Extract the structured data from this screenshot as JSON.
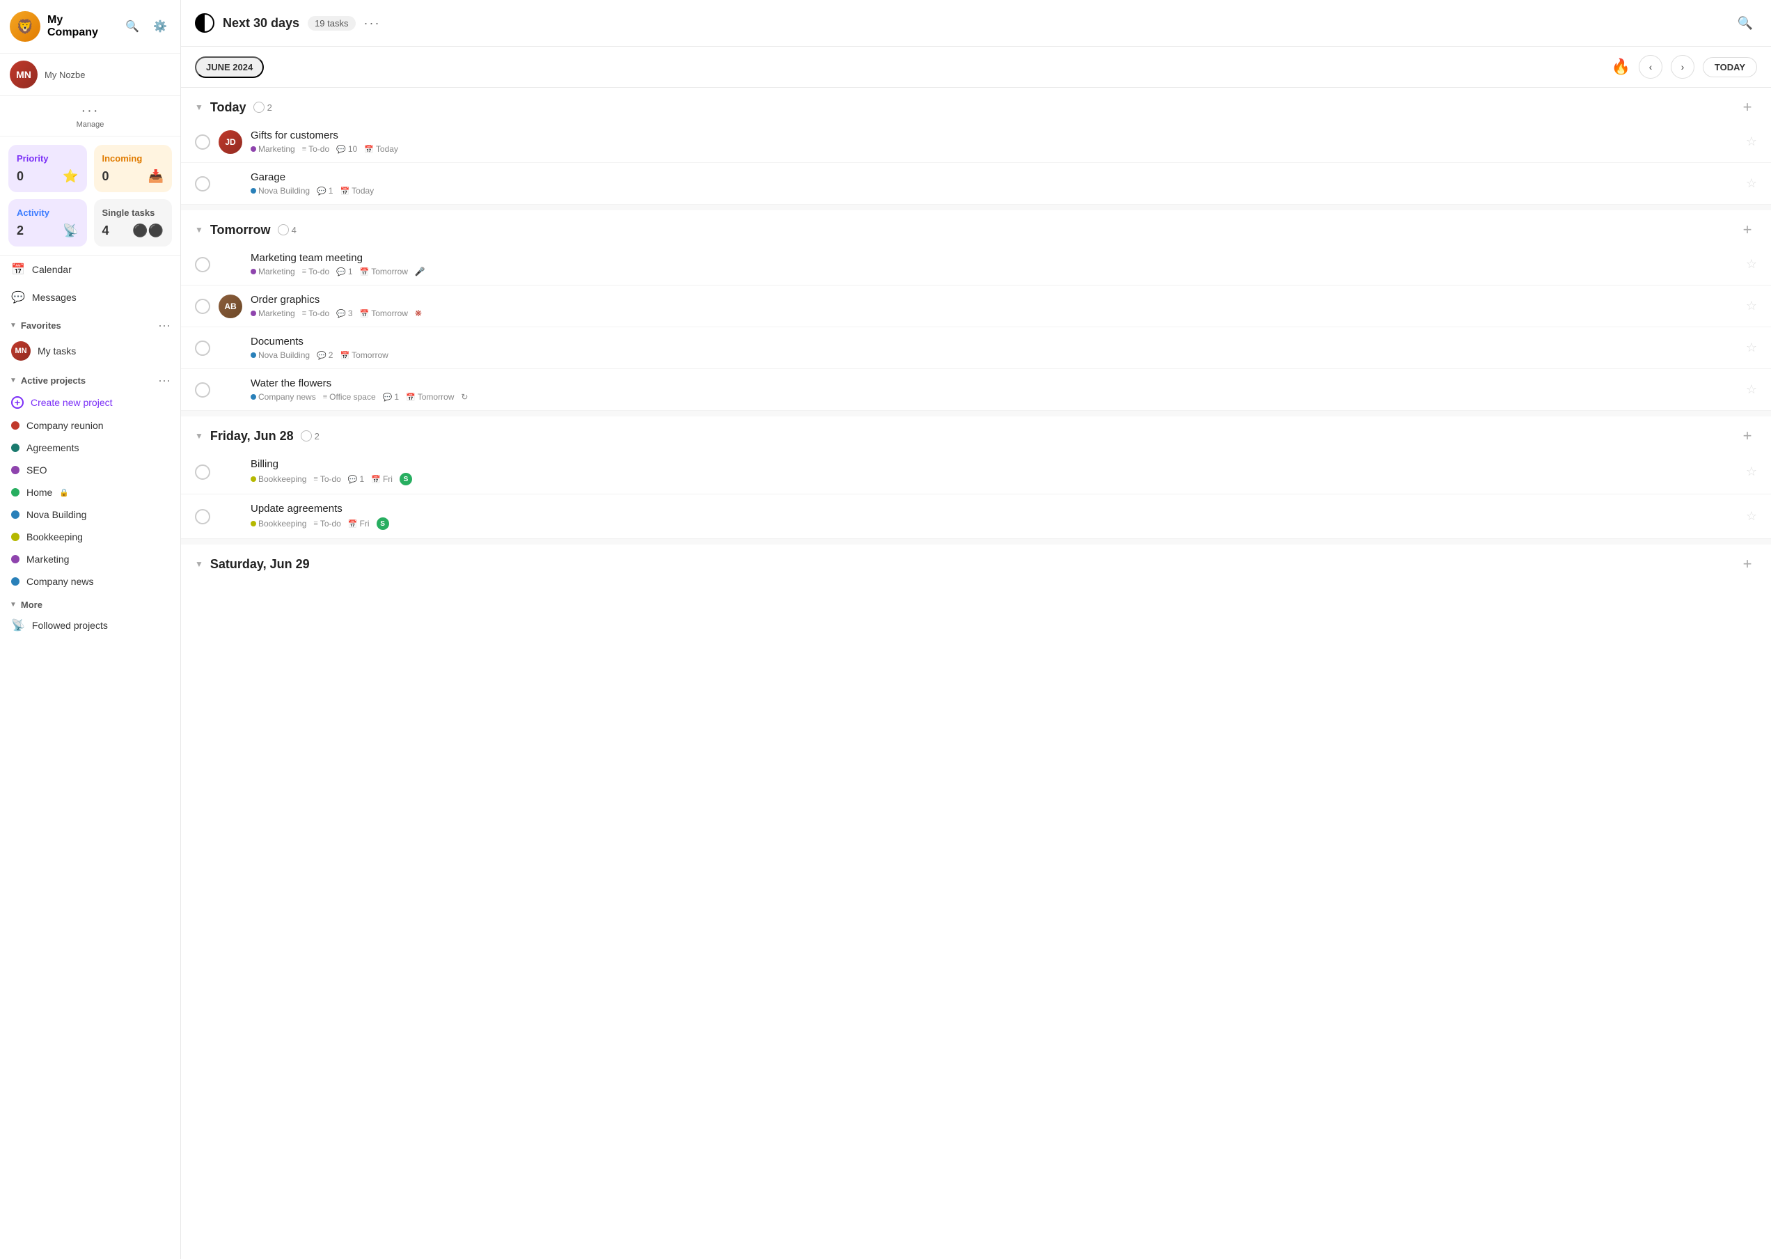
{
  "company": {
    "name": "My Company",
    "logo_emoji": "🦁"
  },
  "user": {
    "name": "My Nozbe",
    "initials": "MN"
  },
  "manage_label": "Manage",
  "stats": {
    "priority": {
      "label": "Priority",
      "count": "0",
      "icon": "⭐"
    },
    "incoming": {
      "label": "Incoming",
      "count": "0",
      "icon": "📥"
    },
    "activity": {
      "label": "Activity",
      "count": "2",
      "icon": "📡"
    },
    "single": {
      "label": "Single tasks",
      "count": "4",
      "icon": "⚫⚫"
    }
  },
  "nav": {
    "calendar": "Calendar",
    "messages": "Messages"
  },
  "favorites": {
    "label": "Favorites",
    "items": [
      {
        "label": "My tasks",
        "color": "#c0392b"
      }
    ]
  },
  "active_projects": {
    "label": "Active projects",
    "create_label": "Create new project",
    "items": [
      {
        "label": "Company reunion",
        "color": "#c0392b"
      },
      {
        "label": "Agreements",
        "color": "#1a7a6e"
      },
      {
        "label": "SEO",
        "color": "#8e44ad"
      },
      {
        "label": "Home",
        "color": "#27ae60",
        "locked": true
      },
      {
        "label": "Nova Building",
        "color": "#2980b9"
      },
      {
        "label": "Bookkeeping",
        "color": "#b5b800"
      },
      {
        "label": "Marketing",
        "color": "#8e44ad"
      },
      {
        "label": "Company news",
        "color": "#2980b9"
      }
    ]
  },
  "more": {
    "label": "More",
    "items": [
      {
        "label": "Followed projects"
      }
    ]
  },
  "header": {
    "title": "Next 30 days",
    "task_count": "19 tasks"
  },
  "calendar_header": {
    "month": "JUNE 2024",
    "today_label": "TODAY"
  },
  "sections": [
    {
      "id": "today",
      "title": "Today",
      "count": "2",
      "tasks": [
        {
          "id": "gifts",
          "name": "Gifts for customers",
          "has_avatar": true,
          "avatar_style": "red",
          "project": "Marketing",
          "project_color": "#8e44ad",
          "category": "To-do",
          "comments": "10",
          "date": "Today"
        },
        {
          "id": "garage",
          "name": "Garage",
          "has_avatar": false,
          "project": "Nova Building",
          "project_color": "#2980b9",
          "comments": "1",
          "date": "Today"
        }
      ]
    },
    {
      "id": "tomorrow",
      "title": "Tomorrow",
      "count": "4",
      "tasks": [
        {
          "id": "marketing-meeting",
          "name": "Marketing team meeting",
          "has_avatar": false,
          "project": "Marketing",
          "project_color": "#8e44ad",
          "category": "To-do",
          "comments": "1",
          "date": "Tomorrow",
          "extra_icon": "🎤"
        },
        {
          "id": "order-graphics",
          "name": "Order graphics",
          "has_avatar": true,
          "avatar_style": "brown",
          "project": "Marketing",
          "project_color": "#8e44ad",
          "category": "To-do",
          "comments": "3",
          "date": "Tomorrow",
          "extra_icon": "❋"
        },
        {
          "id": "documents",
          "name": "Documents",
          "has_avatar": false,
          "project": "Nova Building",
          "project_color": "#2980b9",
          "comments": "2",
          "date": "Tomorrow"
        },
        {
          "id": "water-flowers",
          "name": "Water the flowers",
          "has_avatar": false,
          "project": "Company news",
          "project_color": "#2980b9",
          "category": "Office space",
          "comments": "1",
          "date": "Tomorrow",
          "has_repeat": true
        }
      ]
    },
    {
      "id": "fri-jun28",
      "title": "Friday, Jun 28",
      "count": "2",
      "tasks": [
        {
          "id": "billing",
          "name": "Billing",
          "has_avatar": false,
          "project": "Bookkeeping",
          "project_color": "#b5b800",
          "category": "To-do",
          "comments": "1",
          "date": "Fri",
          "assignee_badge": "S"
        },
        {
          "id": "update-agreements",
          "name": "Update agreements",
          "has_avatar": false,
          "project": "Bookkeeping",
          "project_color": "#b5b800",
          "category": "To-do",
          "date": "Fri",
          "assignee_badge": "S"
        }
      ]
    },
    {
      "id": "sat-jun29",
      "title": "Saturday, Jun 29",
      "count": "",
      "tasks": []
    }
  ]
}
